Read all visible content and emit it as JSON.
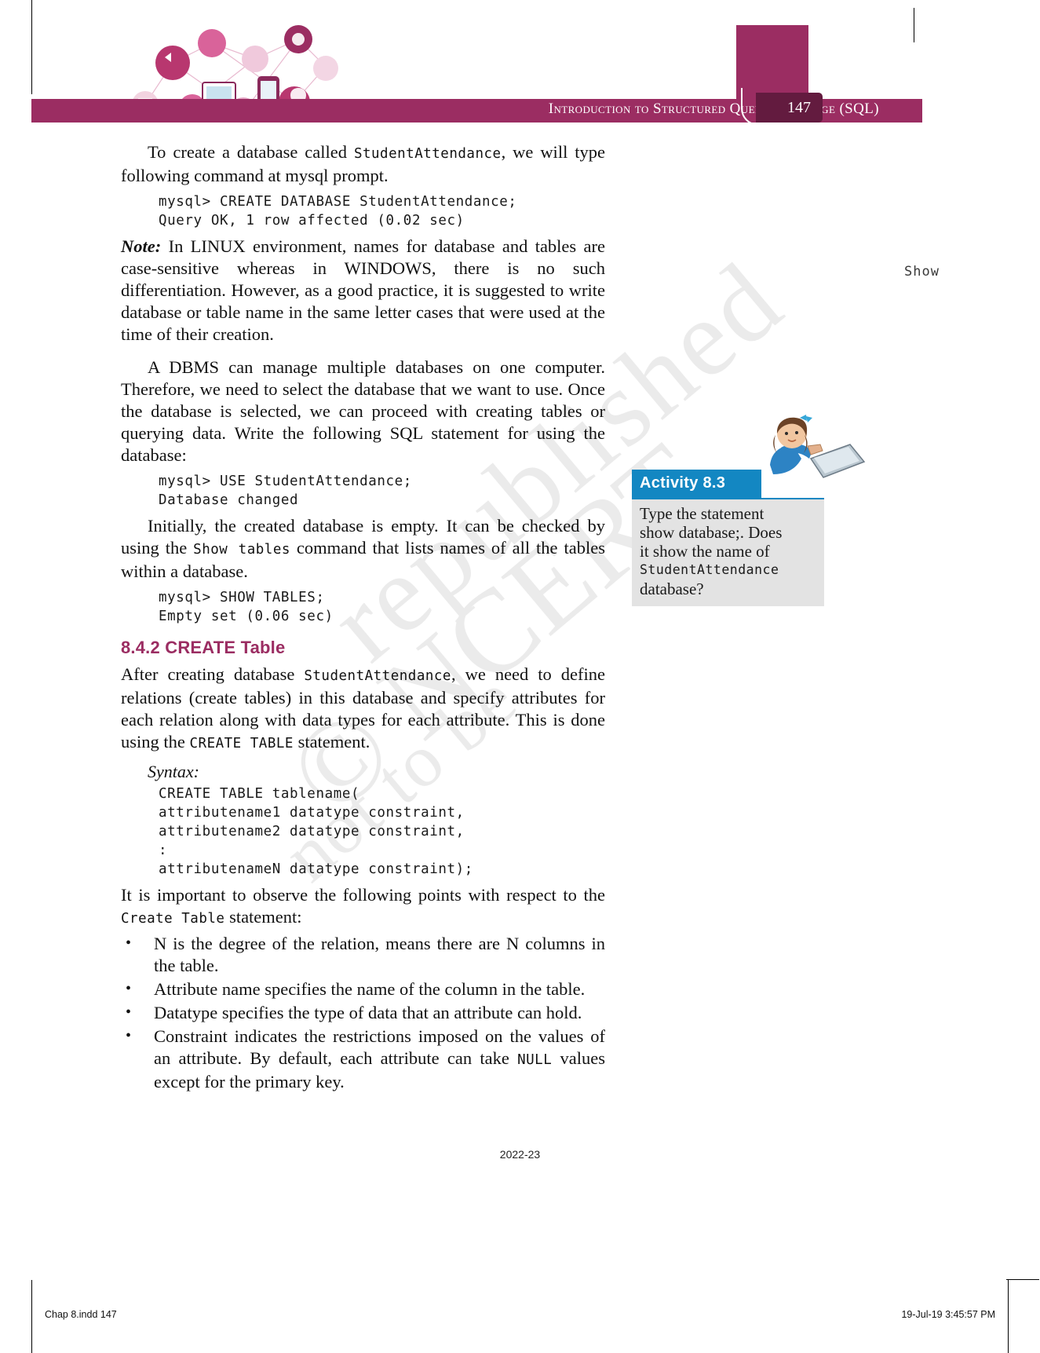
{
  "header": {
    "title": "Introduction to Structured Query Language (SQL)",
    "page_number": "147",
    "band_color": "#9b2d62",
    "tab_color": "#631b3f"
  },
  "margin_note": "Show",
  "content": {
    "para_1": "To create a database called StudentAttendance, we will type following command at mysql prompt.",
    "para_1_parts": {
      "before": "To create a database called ",
      "code": "StudentAttendance",
      "after": ", we will type following command at mysql prompt."
    },
    "code_1": "mysql> CREATE DATABASE StudentAttendance;\nQuery OK, 1 row affected (0.02 sec)",
    "note_label": "Note:",
    "note_text": " In LINUX environment, names for database and tables are case-sensitive whereas in WINDOWS, there is no such differentiation. However, as a good practice, it is suggested to write database or table name in the same letter cases that were used at the time of their creation.",
    "para_2": "A DBMS can manage multiple databases on one computer. Therefore, we need to select the database that we want to use. Once the database is selected, we can proceed with creating tables or querying data. Write the following SQL statement for using the database:",
    "code_2": "mysql> USE StudentAttendance;\nDatabase changed",
    "para_3_parts": {
      "before": "Initially, the created database is empty. It can be checked by using the ",
      "code": "Show tables",
      "after": " command that lists names of all the tables within a database."
    },
    "code_3": "mysql> SHOW TABLES;\nEmpty set (0.06 sec)",
    "section_heading": "8.4.2 CREATE Table",
    "para_4_parts": {
      "before": "After creating database ",
      "code1": "StudentAttendance",
      "middle": ", we need to define relations (create tables) in this database and specify attributes for each relation along with data types for each attribute. This is done using the ",
      "code2": "CREATE TABLE",
      "after": " statement."
    },
    "syntax_label": "Syntax:",
    "code_4": "CREATE TABLE tablename(\nattributename1 datatype constraint,\nattributename2 datatype constraint,\n:\nattributenameN datatype constraint);",
    "para_5_parts": {
      "before": "It is important to observe the following points with respect to the ",
      "code": "Create Table",
      "after": " statement:"
    },
    "bullets": [
      {
        "text": "N is the degree of the relation, means there are N columns in the table."
      },
      {
        "text": "Attribute name specifies the name of the column in the table."
      },
      {
        "text": "Datatype specifies the type of data that an attribute can hold."
      },
      {
        "before": "Constraint indicates the restrictions imposed on the values of an attribute. By default, each attribute can take ",
        "code": "NULL",
        "after": " values except for the primary key."
      }
    ]
  },
  "activity": {
    "title": "Activity 8.3",
    "header_color": "#1387c2",
    "body_color": "#e3e3e3",
    "line_1": "Type the statement",
    "line_2": "show database;.  Does",
    "line_3": "it show the name of",
    "line_4_code": "StudentAttendance",
    "line_5": "database?"
  },
  "watermark": {
    "line_1": "© NCERT",
    "line_2": "not to be",
    "line_3": "republished"
  },
  "footer": {
    "year": "2022-23",
    "file_label": "Chap 8.indd   147",
    "timestamp": "19-Jul-19   3:45:57 PM"
  }
}
